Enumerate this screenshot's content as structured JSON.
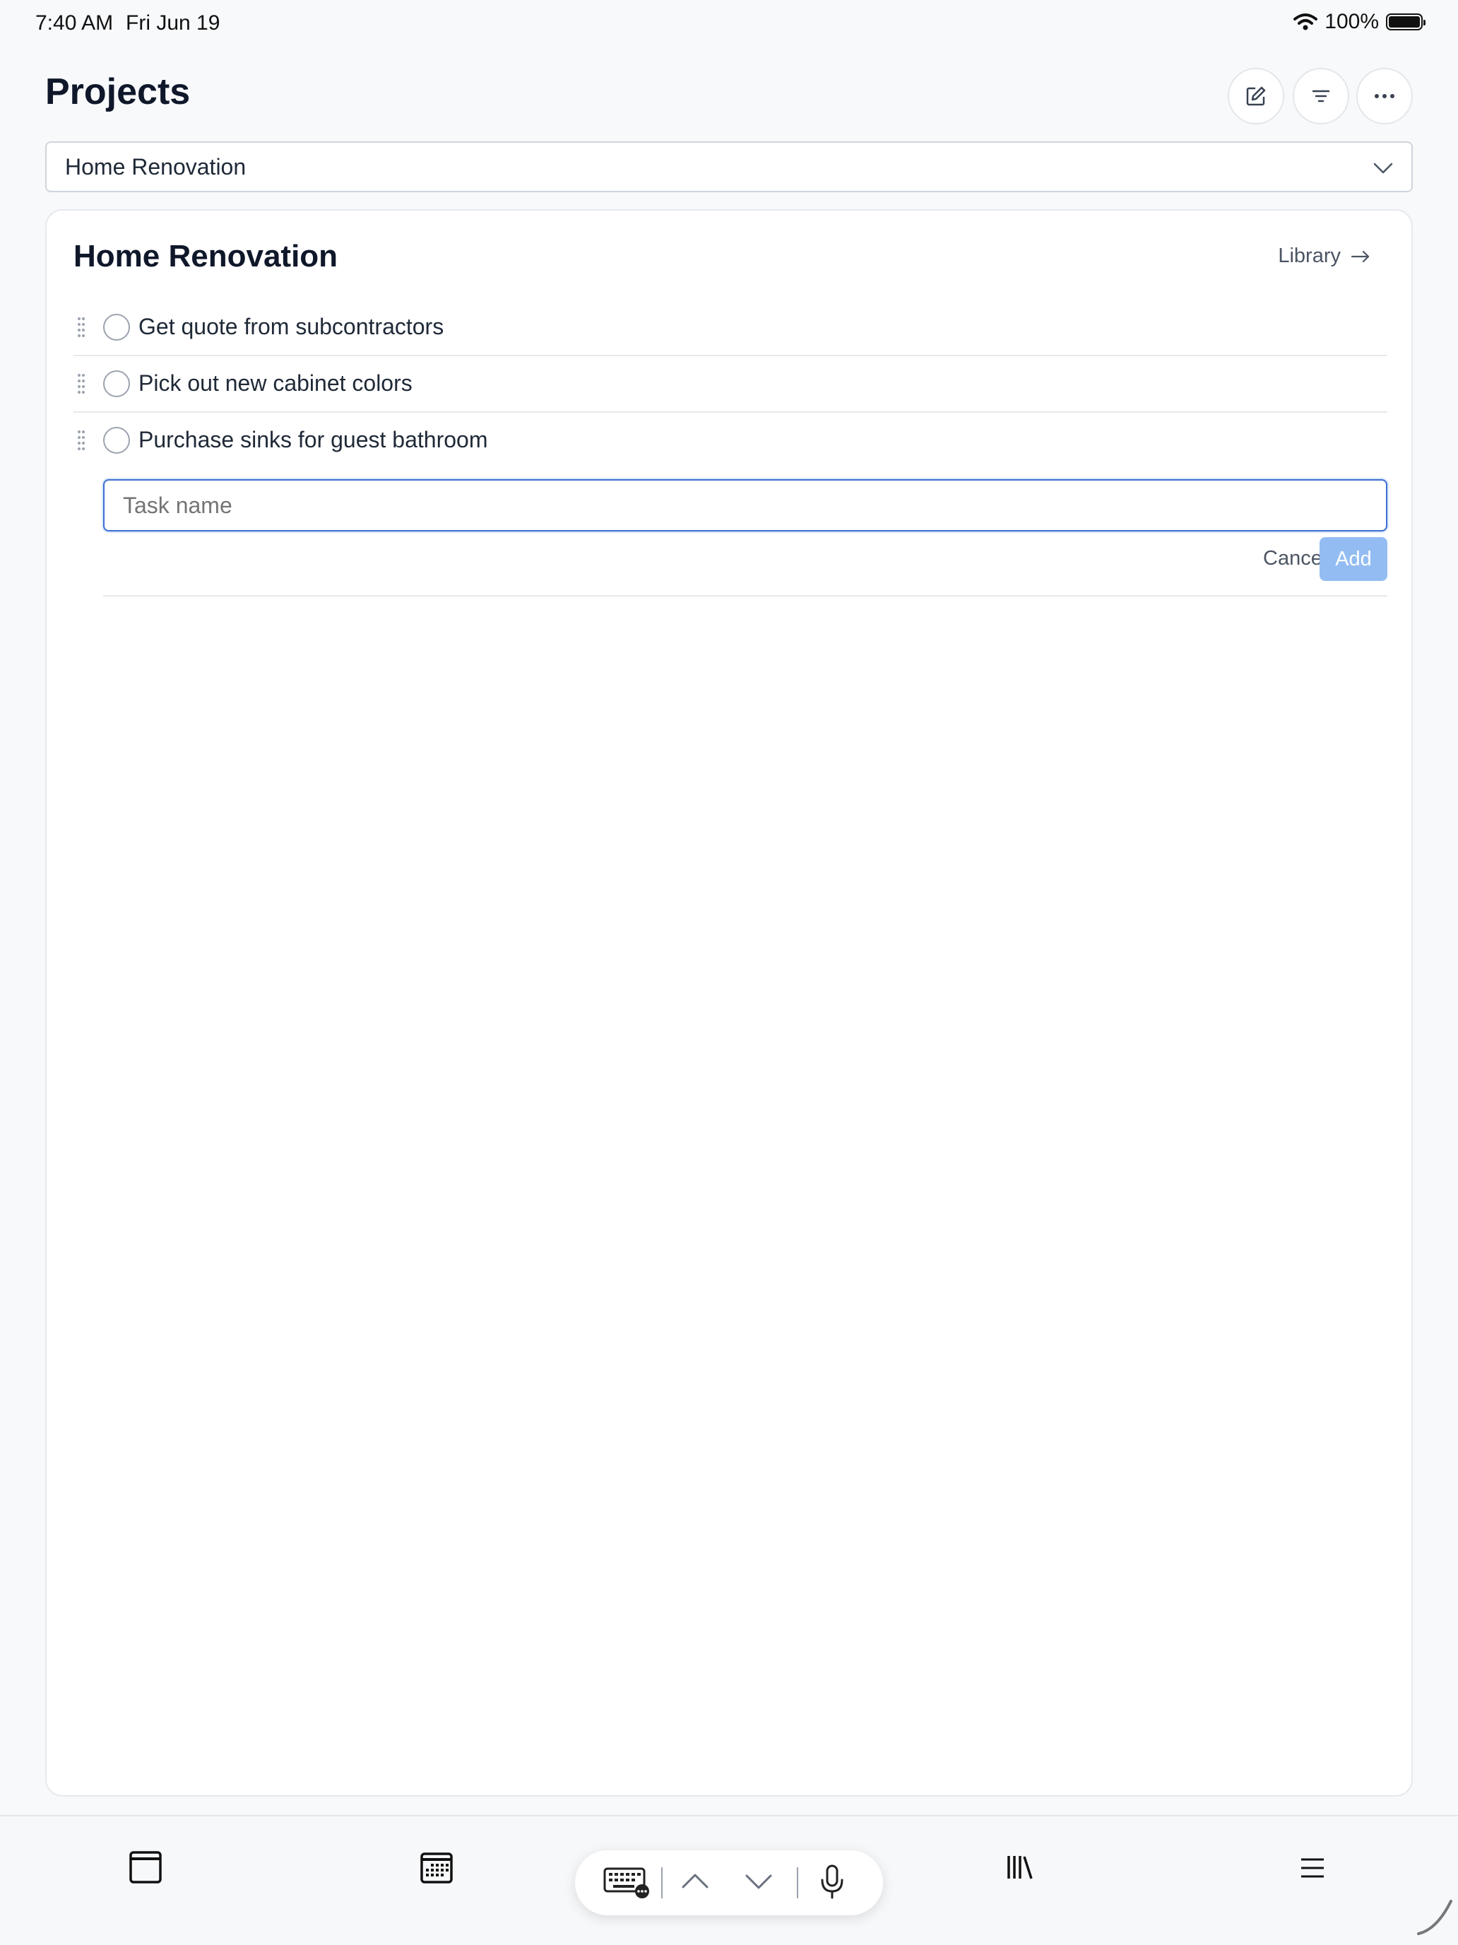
{
  "status": {
    "time": "7:40 AM",
    "date": "Fri Jun 19",
    "battery": "100%"
  },
  "header": {
    "title": "Projects"
  },
  "project_select": {
    "value": "Home Renovation"
  },
  "card": {
    "title": "Home Renovation",
    "library_label": "Library",
    "tasks": [
      {
        "label": "Get quote from subcontractors",
        "done": false
      },
      {
        "label": "Pick out new cabinet colors",
        "done": false
      },
      {
        "label": "Purchase sinks for guest bathroom",
        "done": false
      }
    ],
    "new_task": {
      "placeholder": "Task name",
      "value": ""
    },
    "cancel_label": "Cancel",
    "add_label": "Add"
  },
  "colors": {
    "accent": "#3b6fd1",
    "add_button": "#93bdf2",
    "title": "#0f172a"
  },
  "tabbar": {
    "icons": [
      "window-icon",
      "calendar-icon",
      "keyboard-icon",
      "chevron-up-icon",
      "chevron-down-icon",
      "microphone-icon",
      "library-icon",
      "menu-icon"
    ]
  }
}
